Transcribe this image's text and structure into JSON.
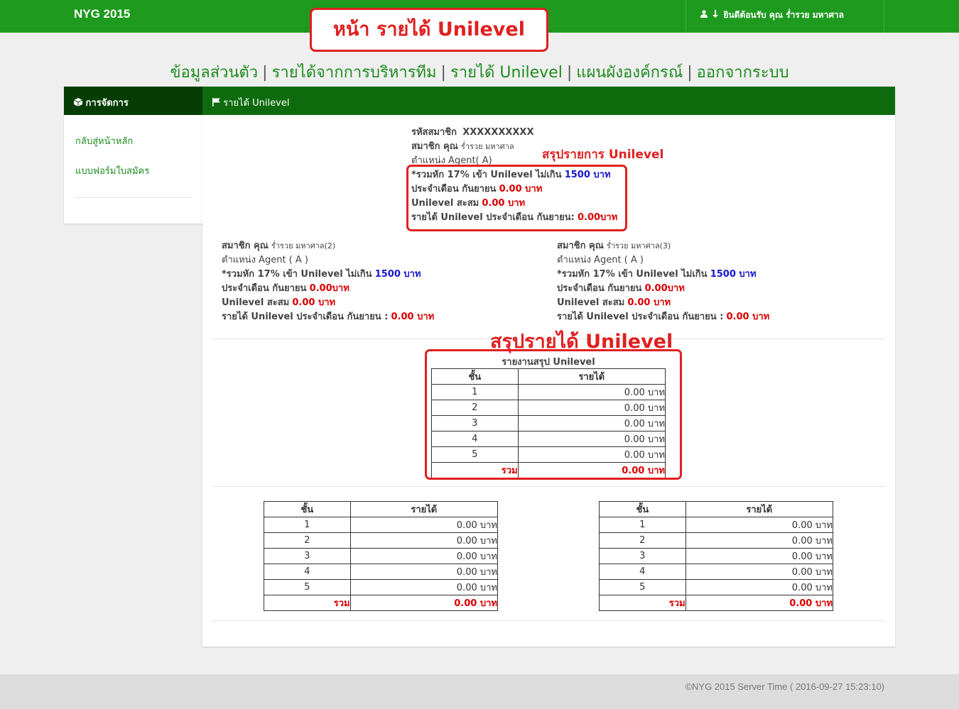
{
  "header": {
    "brand": "NYG 2015",
    "welcome": "ยินดีต้อนรับ คุณ ร่ำรวย มหาศาล",
    "user_icon": "user-icon",
    "arrow_icon": "arrow-down-icon"
  },
  "callouts": {
    "page": "หน้า รายได้ Unilevel",
    "summary_list": "สรุปรายการ Unilevel",
    "summary_income": "สรุปรายได้ Unilevel"
  },
  "nav": {
    "profile": "ข้อมูลส่วนตัว",
    "team_income": "รายได้จากการบริหารทีม",
    "unilevel_income": "รายได้ Unilevel",
    "org_chart": "แผนผังองค์กรณ์",
    "logout": "ออกจากระบบ",
    "separator": "|"
  },
  "sidebar": {
    "title": "การจัดการ",
    "title_icon": "box-icon",
    "items": [
      {
        "label": "กลับสู่หน้าหลัก"
      },
      {
        "label": "แบบฟอร์มใบสมัคร"
      }
    ]
  },
  "main": {
    "title": "รายได้ Unilevel",
    "title_icon": "flag-icon",
    "member": {
      "id_label": "รหัสสมาชิก",
      "id_value": "XXXXXXXXXX",
      "name_label": "สมาชิก คุณ",
      "name_value": "ร่ำรวย มหาศาล",
      "position": "ตำแหน่ง Agent( A)",
      "deduct_label": "*รวมหัก 17% เข้า Unilevel ไม่เกิน",
      "deduct_value": "1500 บาท",
      "month_label": "ประจำเดือน กันยายน",
      "month_value": "0.00 บาท",
      "accum_label": "Unilevel สะสม",
      "accum_value": "0.00 บาท",
      "income_label": "รายได้ Unilevel ประจำเดือน กันยายน:",
      "income_value": "0.00บาท"
    },
    "member2": {
      "name_label": "สมาชิก คุณ",
      "name_value": "ร่ำรวย มหาศาล(2)",
      "position": "ตำแหน่ง Agent ( A )",
      "deduct_label": "*รวมหัก 17% เข้า Unilevel ไม่เกิน",
      "deduct_value": "1500 บาท",
      "month_label": "ประจำเดือน กันยายน",
      "month_value": "0.00บาท",
      "accum_label": "Unilevel สะสม",
      "accum_value": "0.00 บาท",
      "income_label": "รายได้ Unilevel ประจำเดือน กันยายน :",
      "income_value": "0.00 บาท"
    },
    "member3": {
      "name_label": "สมาชิก คุณ",
      "name_value": "ร่ำรวย มหาศาล(3)",
      "position": "ตำแหน่ง Agent ( A )",
      "deduct_label": "*รวมหัก 17% เข้า Unilevel ไม่เกิน",
      "deduct_value": "1500 บาท",
      "month_label": "ประจำเดือน กันยายน",
      "month_value": "0.00บาท",
      "accum_label": "Unilevel สะสม",
      "accum_value": "0.00 บาท",
      "income_label": "รายได้ Unilevel ประจำเดือน กันยายน :",
      "income_value": "0.00 บาท"
    },
    "summary_table": {
      "caption": "รายงานสรุป Unilevel",
      "col_level": "ชั้น",
      "col_income": "รายได้",
      "rows": [
        {
          "level": "1",
          "income": "0.00 บาท"
        },
        {
          "level": "2",
          "income": "0.00 บาท"
        },
        {
          "level": "3",
          "income": "0.00 บาท"
        },
        {
          "level": "4",
          "income": "0.00 บาท"
        },
        {
          "level": "5",
          "income": "0.00 บาท"
        }
      ],
      "total_label": "รวม",
      "total_value": "0.00 บาท"
    },
    "table_left": {
      "col_level": "ชั้น",
      "col_income": "รายได้",
      "rows": [
        {
          "level": "1",
          "income": "0.00 บาท"
        },
        {
          "level": "2",
          "income": "0.00 บาท"
        },
        {
          "level": "3",
          "income": "0.00 บาท"
        },
        {
          "level": "4",
          "income": "0.00 บาท"
        },
        {
          "level": "5",
          "income": "0.00 บาท"
        }
      ],
      "total_label": "รวม",
      "total_value": "0.00 บาท"
    },
    "table_right": {
      "col_level": "ชั้น",
      "col_income": "รายได้",
      "rows": [
        {
          "level": "1",
          "income": "0.00 บาท"
        },
        {
          "level": "2",
          "income": "0.00 บาท"
        },
        {
          "level": "3",
          "income": "0.00 บาท"
        },
        {
          "level": "4",
          "income": "0.00 บาท"
        },
        {
          "level": "5",
          "income": "0.00 บาท"
        }
      ],
      "total_label": "รวม",
      "total_value": "0.00 บาท"
    }
  },
  "footer": {
    "text": "©NYG 2015 Server Time ( 2016-09-27 15:23:10)"
  },
  "colors": {
    "topbar": "#1e9a1e",
    "sidebar_header": "#053d05",
    "main_header": "#0d6b0d",
    "link": "#1e8c1e",
    "highlight_red": "#e02020",
    "value_blue": "#1515cc"
  }
}
